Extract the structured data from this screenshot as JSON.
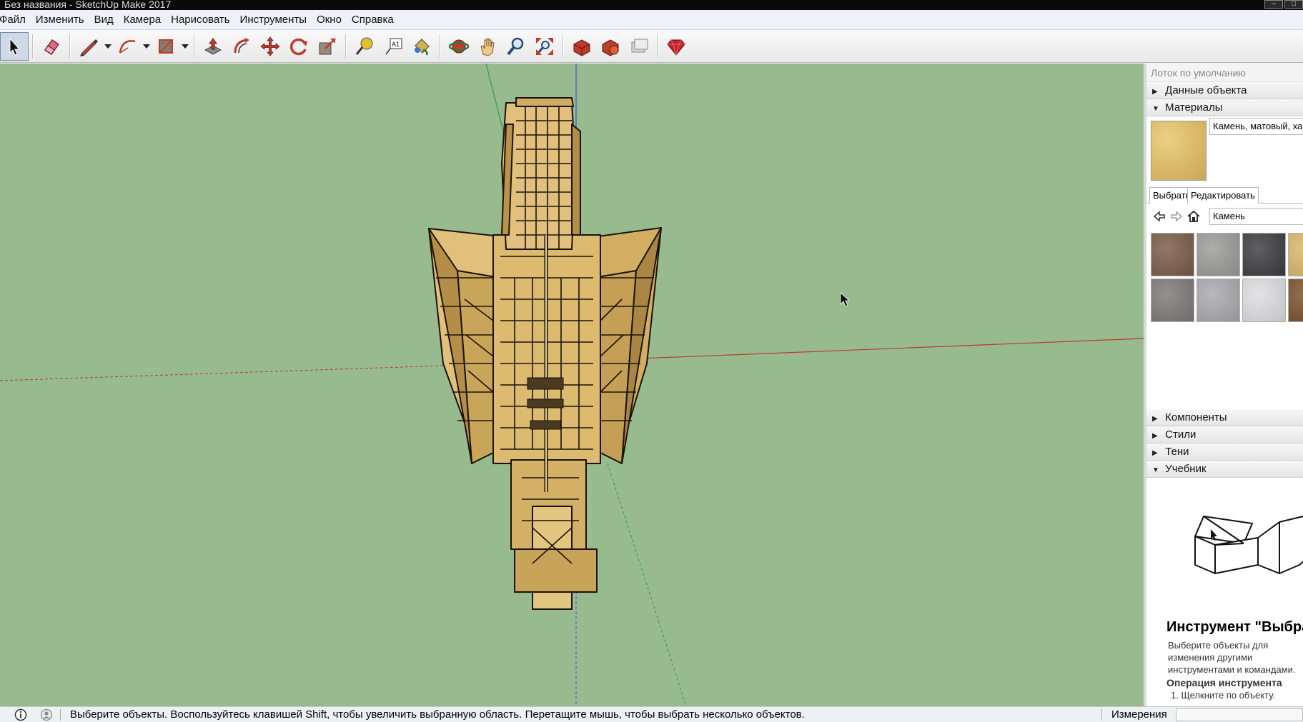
{
  "window": {
    "title": "Без названия - SketchUp Make 2017"
  },
  "menu": [
    {
      "label": "Файл"
    },
    {
      "label": "Изменить"
    },
    {
      "label": "Вид"
    },
    {
      "label": "Камера"
    },
    {
      "label": "Нарисовать"
    },
    {
      "label": "Инструменты"
    },
    {
      "label": "Окно"
    },
    {
      "label": "Справка"
    }
  ],
  "toolbar": {
    "tools": [
      {
        "icon": "select-arrow-icon",
        "active": true
      },
      {
        "icon": "eraser-icon"
      },
      {
        "icon": "pencil-line-icon",
        "dropdown": true
      },
      {
        "icon": "arc-icon",
        "dropdown": true
      },
      {
        "icon": "rectangle-shape-icon",
        "dropdown": true
      },
      {
        "icon": "push-pull-icon"
      },
      {
        "icon": "offset-icon"
      },
      {
        "icon": "move-icon"
      },
      {
        "icon": "rotate-icon"
      },
      {
        "icon": "scale-icon"
      },
      {
        "icon": "tape-measure-icon"
      },
      {
        "icon": "text-label-icon",
        "text": "A1"
      },
      {
        "icon": "paint-bucket-icon"
      },
      {
        "icon": "orbit-icon"
      },
      {
        "icon": "pan-hand-icon"
      },
      {
        "icon": "zoom-icon"
      },
      {
        "icon": "zoom-extents-icon"
      },
      {
        "icon": "warehouse-icon"
      },
      {
        "icon": "extension-warehouse-icon"
      },
      {
        "icon": "share-model-icon"
      },
      {
        "icon": "ruby-gem-icon"
      }
    ]
  },
  "tray": {
    "title": "Лоток по умолчанию",
    "panels": {
      "entity_info": "Данные объекта",
      "materials": "Материалы",
      "components": "Компоненты",
      "styles": "Стили",
      "shadows": "Тени",
      "instructor": "Учебник"
    },
    "materials": {
      "current_name": "Камень, матовый, хаки",
      "tab_select": "Выбрать",
      "tab_edit": "Редактировать",
      "library": "Камень",
      "swatches": [
        {
          "color": "#7a5a48"
        },
        {
          "color": "#9a9a98"
        },
        {
          "color": "#3c3c3e"
        },
        {
          "color": "#d9b56a"
        },
        {
          "color": "#7d7877"
        },
        {
          "color": "#a9a9ad"
        },
        {
          "color": "#dedee0"
        },
        {
          "color": "#7a4e2a"
        }
      ]
    },
    "instructor": {
      "tool_title": "Инструмент \"Выбрать\"",
      "description": "Выберите объекты для изменения другими инструментами и командами.",
      "operation_title": "Операция инструмента",
      "step1": "1. Щелкните по объекту."
    }
  },
  "status": {
    "message": "Выберите объекты. Воспользуйтесь клавишей Shift, чтобы увеличить выбранную область. Перетащите мышь, чтобы выбрать несколько объектов.",
    "measurements_label": "Измерения",
    "measurements_value": ""
  },
  "colors": {
    "viewport_bg": "#97bb8f",
    "model_face": "#d9b56a",
    "axis_red": "#c0392b",
    "axis_green": "#2e9e3a",
    "axis_blue": "#3b5bd6"
  }
}
